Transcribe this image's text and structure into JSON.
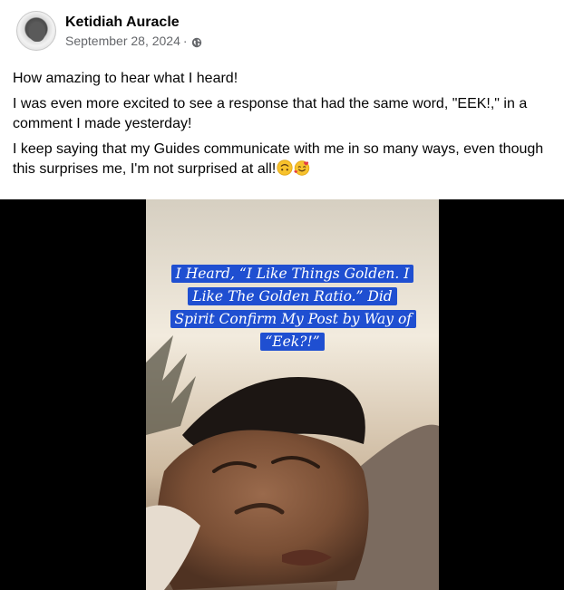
{
  "post": {
    "author": "Ketidiah Auracle",
    "date": "September 28, 2024",
    "separator": "·",
    "privacy_icon": "globe-icon",
    "paragraphs": [
      "How amazing to hear what I heard!",
      "I was even more excited to see a response that had the same word, \"EEK!,\" in a comment I made yesterday!",
      "I keep saying that my Guides communicate with me in so many ways, even though this surprises me, I'm not surprised at all!"
    ],
    "emojis": [
      "upside-down-face-emoji",
      "smiling-face-with-hearts-emoji"
    ]
  },
  "media": {
    "overlay_text": "I Heard, “I Like Things Golden. I Like The Golden Ratio.” Did Spirit Confirm My Post by Way of “Eek?!”",
    "overlay_color": "#1f4fd1"
  }
}
